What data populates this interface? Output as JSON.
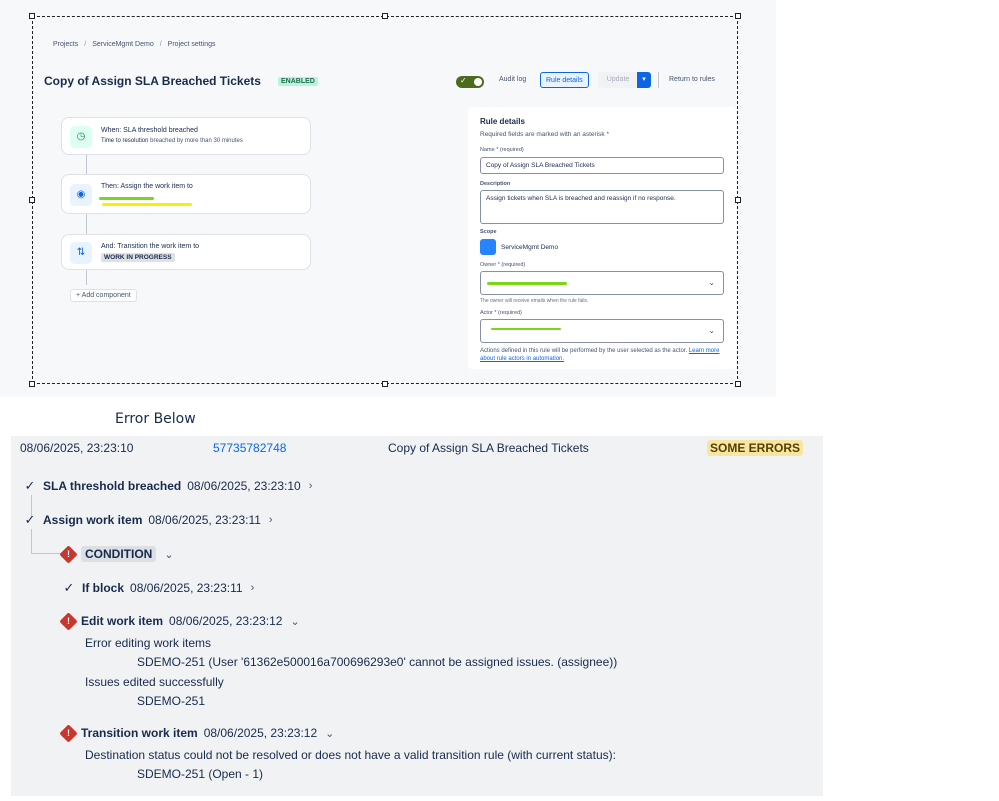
{
  "breadcrumb": [
    "Projects",
    "ServiceMgmt Demo",
    "Project settings"
  ],
  "rule": {
    "title": "Copy of Assign SLA Breached Tickets",
    "status_badge": "ENABLED"
  },
  "toolbar": {
    "audit_log": "Audit log",
    "rule_details": "Rule details",
    "update": "Update",
    "return": "Return to rules"
  },
  "flow": {
    "step1_title": "When: SLA threshold breached",
    "step1_sub_label": "Time to resolution",
    "step1_sub_detail": "breached by more than 30 minutes",
    "step2_title": "Then: Assign the work item to",
    "step3_title": "And: Transition the work item to",
    "step3_status": "WORK IN PROGRESS",
    "add_component": "Add component"
  },
  "details": {
    "title": "Rule details",
    "subtitle": "Required fields are marked with an asterisk *",
    "name_label": "Name *",
    "name_req": "(required)",
    "name_value": "Copy of Assign SLA Breached Tickets",
    "description_label": "Description",
    "description_value": "Assign tickets when SLA is breached and reassign if no response.",
    "scope_label": "Scope",
    "scope_value": "ServiceMgmt Demo",
    "owner_label": "Owner *",
    "owner_req": "(required)",
    "owner_help": "The owner will receive emails when the rule fails.",
    "actor_label": "Actor *",
    "actor_req": "(required)",
    "actor_help": "Actions defined in this rule will be performed by the user selected as the actor.",
    "actor_link": "Learn more about rule actors in automation."
  },
  "error_heading": "Error Below",
  "log": {
    "date": "08/06/2025, 23:23:10",
    "id": "57735782748",
    "name": "Copy of Assign SLA Breached Tickets",
    "status": "SOME ERRORS",
    "entries": {
      "sla_label": "SLA threshold breached",
      "sla_time": "08/06/2025, 23:23:10",
      "assign_label": "Assign work item",
      "assign_time": "08/06/2025, 23:23:11",
      "condition_label": "CONDITION",
      "ifblock_label": "If block",
      "ifblock_time": "08/06/2025, 23:23:11",
      "edit_label": "Edit work item",
      "edit_time": "08/06/2025, 23:23:12",
      "edit_error_title": "Error editing work items",
      "edit_error_detail": "SDEMO-251 (User '61362e500016a700696293e0' cannot be assigned issues. (assignee))",
      "edit_success_title": "Issues edited successfully",
      "edit_success_detail": "SDEMO-251",
      "transition_label": "Transition work item",
      "transition_time": "08/06/2025, 23:23:12",
      "transition_error": "Destination status could not be resolved or does not have a valid transition rule (with current status):",
      "transition_detail": "SDEMO-251 (Open - 1)"
    }
  },
  "colors": {
    "accent": "#0c66e4",
    "error": "#c9372c",
    "warning_bg": "#f8e6a0",
    "success_bg": "#baf3db"
  }
}
